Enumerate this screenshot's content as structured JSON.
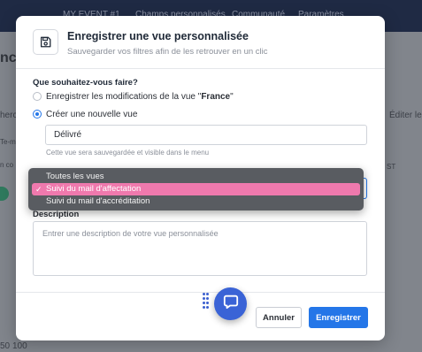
{
  "background": {
    "nav": [
      "MY EVENT #1",
      "Champs personnalisés",
      "Communauté",
      "Paramètres"
    ],
    "page_title_fragment": "nc",
    "search_fragment": "herc",
    "filter_fragment": "Te-m",
    "column_fragment": "n co",
    "right_fragment": "Éditer les",
    "row_fragment": "ST",
    "pager_sizes": [
      "50",
      "100"
    ]
  },
  "modal": {
    "icon": "save-icon",
    "title": "Enregistrer une vue personnalisée",
    "subtitle": "Sauvegarder vos filtres afin de les retrouver en un clic",
    "question": "Que souhaitez-vous faire?",
    "options": [
      {
        "prefix": "Enregistrer les modifications de la vue \"",
        "bold": "France",
        "suffix": "\"",
        "checked": false
      },
      {
        "label": "Créer une nouvelle vue",
        "checked": true
      }
    ],
    "name_value": "Délivré",
    "hint": "Cette vue sera sauvegardée et visible dans le menu",
    "description_label": "Description",
    "description_placeholder": "Entrer une description de votre vue personnalisée",
    "cancel_label": "Annuler",
    "save_label": "Enregistrer"
  },
  "dropdown": {
    "options": [
      "Toutes les vues",
      "Suivi du mail d'affectation",
      "Suivi du mail d'accréditation"
    ],
    "selected_index": 1,
    "selected_color": "#ef79ad"
  },
  "colors": {
    "accent": "#2476e8",
    "chat": "#3a63d6"
  },
  "chat": {
    "icon": "chat-bubble-icon"
  }
}
